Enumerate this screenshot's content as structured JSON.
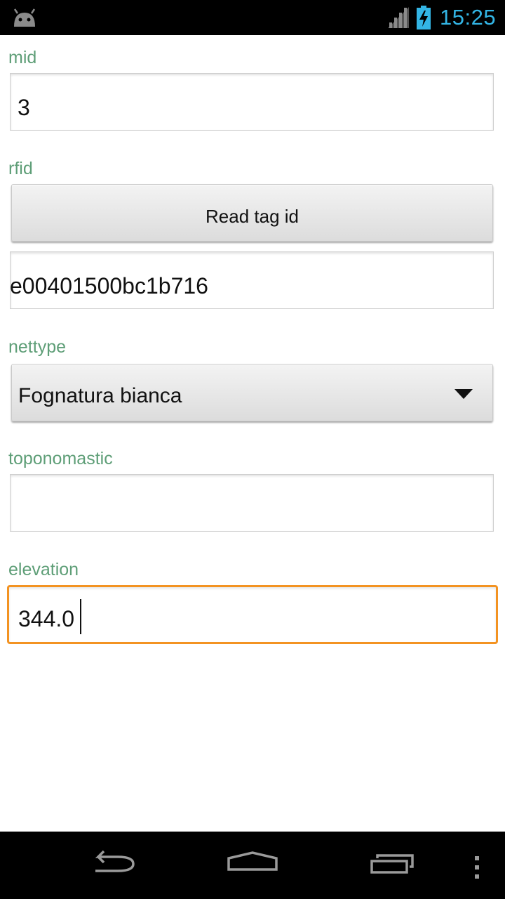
{
  "status_bar": {
    "time": "15:25",
    "icons": [
      "android-icon",
      "signal-icon",
      "battery-charging-icon"
    ],
    "clock_color": "#33b5e5"
  },
  "form": {
    "mid": {
      "label": "mid",
      "value": "3"
    },
    "rfid": {
      "label": "rfid",
      "button_label": "Read tag id",
      "value": "e00401500bc1b716"
    },
    "nettype": {
      "label": "nettype",
      "selected": "Fognatura bianca"
    },
    "toponomastic": {
      "label": "toponomastic",
      "value": ""
    },
    "elevation": {
      "label": "elevation",
      "value": "344.0"
    }
  },
  "colors": {
    "label": "#5e9e77",
    "focus": "#f39322"
  },
  "nav_bar": {
    "icons": [
      "back-icon",
      "home-icon",
      "recent-apps-icon",
      "overflow-menu-icon"
    ]
  }
}
